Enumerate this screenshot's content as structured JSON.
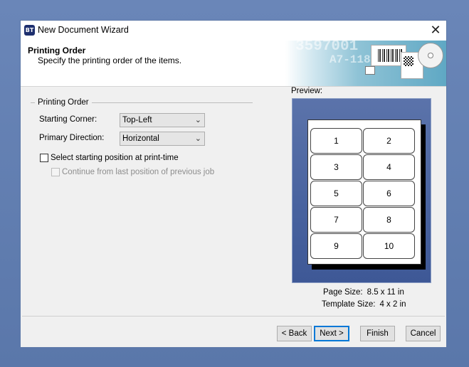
{
  "window": {
    "title": "New Document Wizard",
    "app_icon_text": "BT",
    "close_symbol": "✕"
  },
  "header": {
    "title": "Printing Order",
    "subtitle": "Specify the printing order of the items.",
    "art_numbers": [
      "3597001",
      "A7-118"
    ]
  },
  "printing_order": {
    "group_title": "Printing Order",
    "starting_corner": {
      "label": "Starting Corner:",
      "value": "Top-Left"
    },
    "primary_direction": {
      "label": "Primary Direction:",
      "value": "Horizontal"
    },
    "select_at_print_time": {
      "label": "Select starting position at print-time",
      "checked": false
    },
    "continue_last": {
      "label": "Continue from last position of previous job",
      "checked": false,
      "enabled": false
    }
  },
  "preview": {
    "label": "Preview:",
    "cells": [
      "1",
      "2",
      "3",
      "4",
      "5",
      "6",
      "7",
      "8",
      "9",
      "10"
    ],
    "page_size_label": "Page Size:",
    "page_size_value": "8.5 x 11 in",
    "template_size_label": "Template Size:",
    "template_size_value": "4 x 2 in"
  },
  "buttons": {
    "back": "< Back",
    "next": "Next >",
    "finish": "Finish",
    "cancel": "Cancel"
  },
  "colors": {
    "accent": "#0078d7",
    "preview_bg": "#4a64a0"
  }
}
